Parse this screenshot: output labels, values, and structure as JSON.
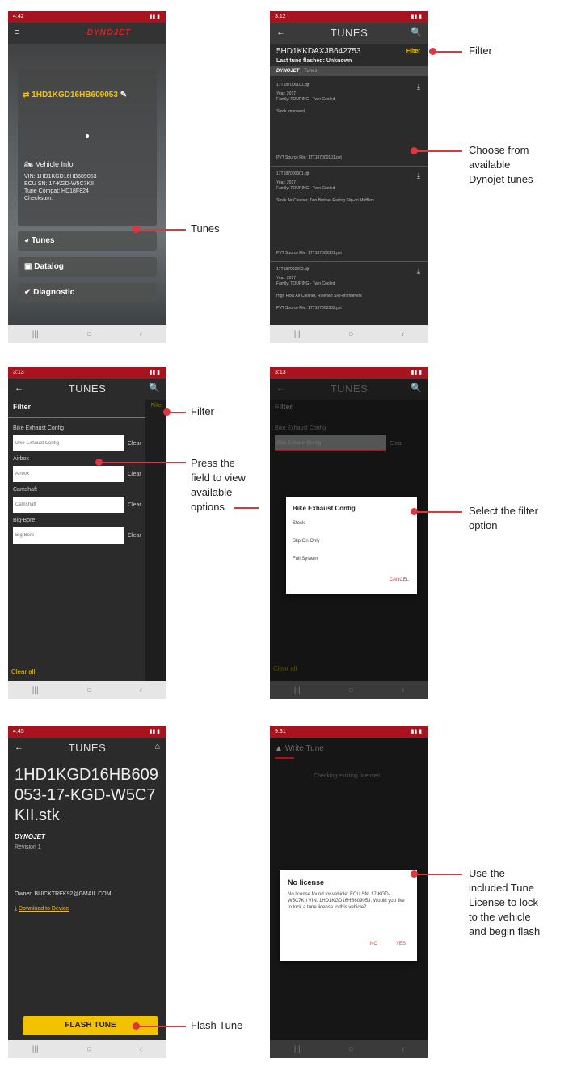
{
  "colors": {
    "status_bar": "#a8141e",
    "accent_yellow": "#f2c200",
    "callout_red": "#e0343f",
    "dark_bg": "#2b2b2b"
  },
  "screen1": {
    "status_time": "4:42",
    "logo": "DYNOJET",
    "vin_title": "1HD1KGD16HB609053",
    "vehicle_info_label": "Vehicle Info",
    "vin_line": "VIN: 1HD1KGD16HB609053",
    "ecu_line": "ECU SN: 17-KGD-W5C7KII",
    "compat_line": "Tune Compat: HD18F824",
    "checksum_line": "Checksum:",
    "menu": [
      {
        "label": "Tunes"
      },
      {
        "label": "Datalog"
      },
      {
        "label": "Diagnostic"
      }
    ]
  },
  "screen2": {
    "status_time": "3:12",
    "title": "TUNES",
    "vin": "5HD1KKDAXJB642753",
    "filter": "Filter",
    "last_flash": "Last tune flashed: Unknown",
    "brand": "DYNOJET",
    "brand_sub": "Tunes",
    "tunes": [
      {
        "file": "17T187000101.djt",
        "year": "Year: 2017",
        "family": "Family: TOURING - Twin Cooled",
        "desc": "Stock Improved",
        "pvt": "PVT Source File: 17T187000101.pvt"
      },
      {
        "file": "17T187000301.djt",
        "year": "Year: 2017",
        "family": "Family: TOURING - Twin Cooled",
        "desc": "Stock Air Cleaner, Two Brother Racing Slip-on Mufflers",
        "pvt": "PVT Source File: 17T187000301.pvt"
      },
      {
        "file": "17T187002302.djt",
        "year": "Year: 2017",
        "family": "Family: TOURING - Twin Cooled",
        "desc": "High Flow Air Cleaner, Rinehart Slip-on mufflers",
        "pvt": "PVT Source File: 17T187002302.pvt"
      }
    ]
  },
  "screen3": {
    "status_time": "3:13",
    "title": "TUNES",
    "panel_title": "Filter",
    "filter_link": "Filter",
    "fields": [
      {
        "label": "Bike Exhaust Config",
        "placeholder": "Bike Exhaust Config",
        "clear": "Clear"
      },
      {
        "label": "Airbox",
        "placeholder": "Airbox",
        "clear": "Clear"
      },
      {
        "label": "Camshaft",
        "placeholder": "Camshaft",
        "clear": "Clear"
      },
      {
        "label": "Big-Bore",
        "placeholder": "Big-Bore",
        "clear": "Clear"
      }
    ],
    "clear_all": "Clear all"
  },
  "screen4": {
    "status_time": "3:13",
    "title": "TUNES",
    "dialog_title": "Bike Exhaust Config",
    "options": [
      "Stock",
      "Slip On Only",
      "Full System"
    ],
    "cancel": "CANCEL",
    "bg_field_label": "Bike Exhaust Config",
    "bg_field_value": "Bike Exhaust Config",
    "bg_clear": "Clear",
    "bg_filter": "Filter",
    "bg_clear_all": "Clear all"
  },
  "screen5": {
    "status_time": "4:45",
    "title": "TUNES",
    "tune_name": "1HD1KGD16HB609053-17-KGD-W5C7KII.stk",
    "brand": "DYNOJET",
    "revision": "Revision 1",
    "owner": "Owner: BUICKTREK92@GMAIL.COM",
    "download": "Download to Device",
    "flash_button": "FLASH TUNE"
  },
  "screen6": {
    "status_time": "9:31",
    "title": "Write Tune",
    "checking": "Checking existing licenses...",
    "dialog_title": "No license",
    "dialog_body": "No license found for vehicle: ECU SN: 17-KGD-W5C7KII VIN: 1HD1KGD16HB609053. Would you like to lock a tune license to this vehicle?",
    "no": "NO",
    "yes": "YES"
  },
  "callouts": {
    "filter1": "Filter",
    "choose": [
      "Choose from",
      "available",
      "Dynojet tunes"
    ],
    "tunes": "Tunes",
    "filter2": "Filter",
    "press": [
      "Press the",
      "field to view",
      "available",
      "options"
    ],
    "select": [
      "Select the filter",
      "option"
    ],
    "use": [
      "Use the",
      "included Tune",
      "License to lock",
      "to the vehicle",
      "and begin flash"
    ],
    "flash": "Flash Tune"
  }
}
